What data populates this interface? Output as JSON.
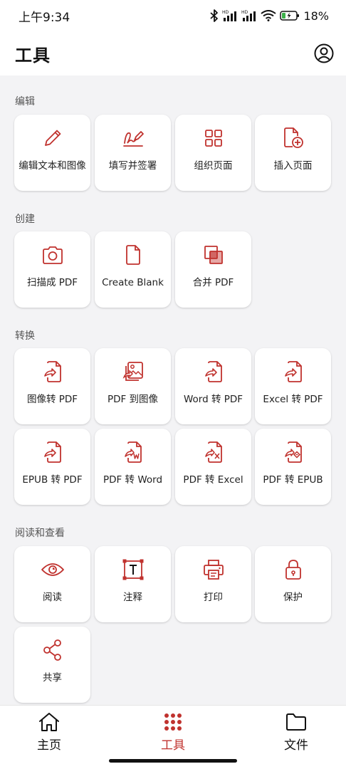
{
  "status_bar": {
    "time": "上午9:34",
    "battery": "18%"
  },
  "header": {
    "title": "工具"
  },
  "sections": {
    "edit": {
      "title": "编辑",
      "items": [
        "编辑文本和图像",
        "填写并签署",
        "组织页面",
        "插入页面"
      ]
    },
    "create": {
      "title": "创建",
      "items": [
        "扫描成 PDF",
        "Create Blank",
        "合并 PDF"
      ]
    },
    "convert": {
      "title": "转换",
      "items": [
        "图像转 PDF",
        "PDF 到图像",
        "Word 转 PDF",
        "Excel 转 PDF",
        "EPUB 转 PDF",
        "PDF 转 Word",
        "PDF 转 Excel",
        "PDF 转 EPUB"
      ]
    },
    "read": {
      "title": "阅读和查看",
      "items": [
        "阅读",
        "注释",
        "打印",
        "保护",
        "共享"
      ]
    }
  },
  "bottom_nav": {
    "items": [
      "主页",
      "工具",
      "文件"
    ],
    "active": "工具"
  },
  "colors": {
    "accent": "#c0322e",
    "background": "#f3f3f5",
    "tile": "#ffffff"
  },
  "icons": {
    "edit": [
      "pencil-icon",
      "signature-pen-icon",
      "grid-pages-icon",
      "insert-page-icon"
    ],
    "create": [
      "camera-icon",
      "blank-page-icon",
      "merge-icon"
    ],
    "convert": [
      "convert-file-icon",
      "image-stack-icon",
      "convert-file-icon",
      "convert-file-icon",
      "convert-file-icon",
      "word-file-icon",
      "excel-file-icon",
      "epub-file-icon"
    ],
    "read": [
      "eye-icon",
      "annotate-icon",
      "printer-icon",
      "lock-icon",
      "share-icon"
    ]
  }
}
